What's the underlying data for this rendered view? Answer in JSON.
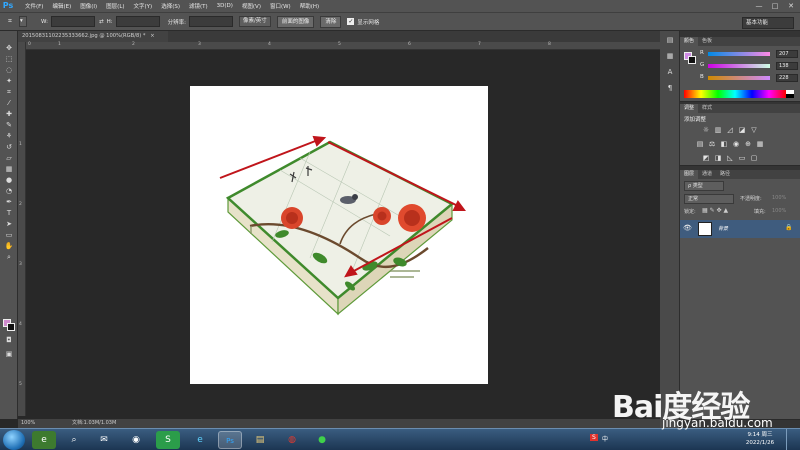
{
  "app": {
    "logo": "Ps",
    "brand_color": "#31a8ff"
  },
  "menu": [
    "文件(F)",
    "编辑(E)",
    "图像(I)",
    "图层(L)",
    "文字(Y)",
    "选择(S)",
    "滤镜(T)",
    "3D(D)",
    "视图(V)",
    "窗口(W)",
    "帮助(H)"
  ],
  "window_buttons": [
    "—",
    "□",
    "✕"
  ],
  "options": {
    "w_label": "W:",
    "h_label": "H:",
    "resolution_label": "分辨率:",
    "unit_select": "像素/英寸",
    "front_image_button": "前面的图像",
    "clear_button": "清除",
    "show_grid_label": "显示网格",
    "show_grid_checked": true,
    "workspace": "基本功能"
  },
  "document": {
    "tab_title": "20150831102235333662.jpg @ 100%(RGB/8) *",
    "close": "×"
  },
  "rulers": {
    "h_ticks": [
      "0",
      "1",
      "2",
      "3",
      "4",
      "5",
      "6",
      "7",
      "8"
    ],
    "v_ticks": [
      "1",
      "2",
      "3",
      "4",
      "5"
    ]
  },
  "status": {
    "zoom": "100%",
    "doc_info": "文档:1.03M/1.03M"
  },
  "color_panel": {
    "tabs": [
      "颜色",
      "色板"
    ],
    "r": 207,
    "g": 138,
    "b": 228,
    "fg_color": "#cf8ae4",
    "bg_color": "#000000"
  },
  "adjust_panel": {
    "tabs": [
      "调整",
      "样式"
    ],
    "title": "添加调整"
  },
  "layers_panel": {
    "tabs": [
      "图层",
      "通道",
      "路径"
    ],
    "kind_filter": "ρ 类型",
    "blend_mode": "正常",
    "opacity_label": "不透明度:",
    "opacity": "100%",
    "lock_label": "锁定:",
    "fill_label": "填充:",
    "fill": "100%",
    "layers": [
      {
        "name": "背景",
        "visible": true,
        "locked": true
      }
    ]
  },
  "taskbar": {
    "apps": [
      "windows-start",
      "web-browser",
      "search",
      "email",
      "chrome",
      "s-app",
      "ie",
      "photoshop",
      "explorer",
      "antivirus",
      "wechat"
    ],
    "ime_label": "中",
    "clock_time": "9:14 周三",
    "clock_date": "2022/1/26"
  },
  "watermark": {
    "text": "Bai度经验",
    "site": "jingyan.baidu.com"
  },
  "canvas": {
    "image": "tin-box-with-rose-print",
    "arrow_color": "#c0151b"
  }
}
